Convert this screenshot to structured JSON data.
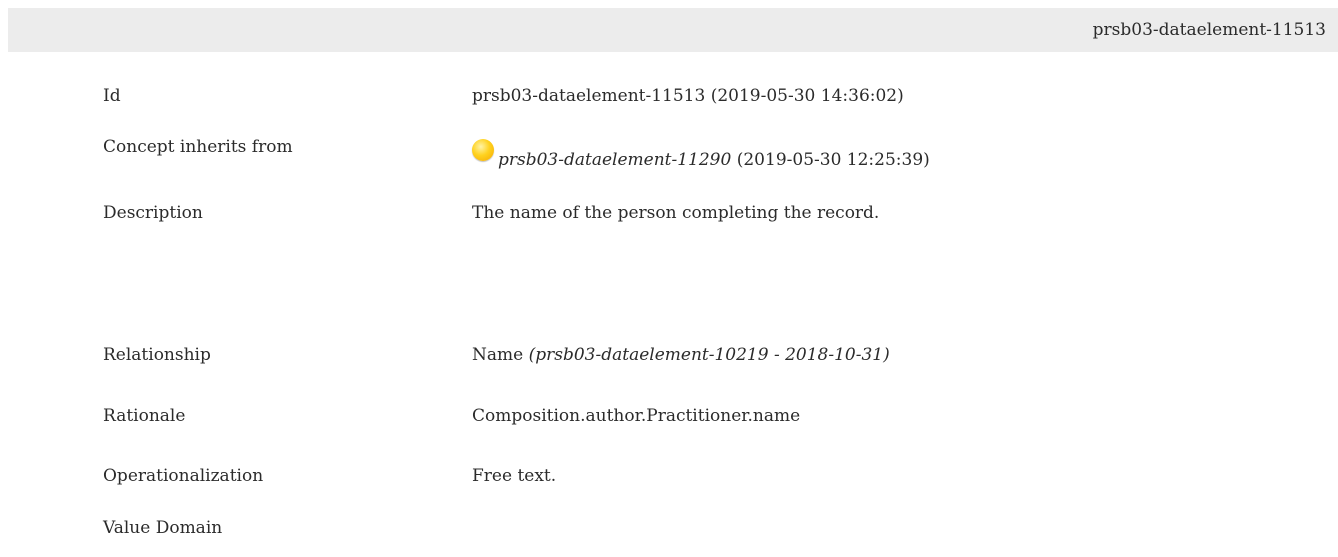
{
  "header": {
    "element_id": "prsb03-dataelement-11513"
  },
  "fields": {
    "id": {
      "label": "Id",
      "value": "prsb03-dataelement-11513 (2019-05-30 14:36:02)"
    },
    "inherits": {
      "label": "Concept inherits from",
      "status_icon": "yellow-status-dot-icon",
      "status_color": "#ffd21f",
      "ref_id": "prsb03-dataelement-11290",
      "ref_date": "(2019-05-30 12:25:39)"
    },
    "description": {
      "label": "Description",
      "value": "The name of the person completing the record."
    },
    "relationship": {
      "label": "Relationship",
      "name": "Name",
      "ref": "(prsb03-dataelement-10219 - 2018-10-31)"
    },
    "rationale": {
      "label": "Rationale",
      "value": "Composition.author.Practitioner.name"
    },
    "operationalization": {
      "label": "Operationalization",
      "value": "Free text."
    },
    "value_domain": {
      "label": "Value Domain"
    }
  }
}
